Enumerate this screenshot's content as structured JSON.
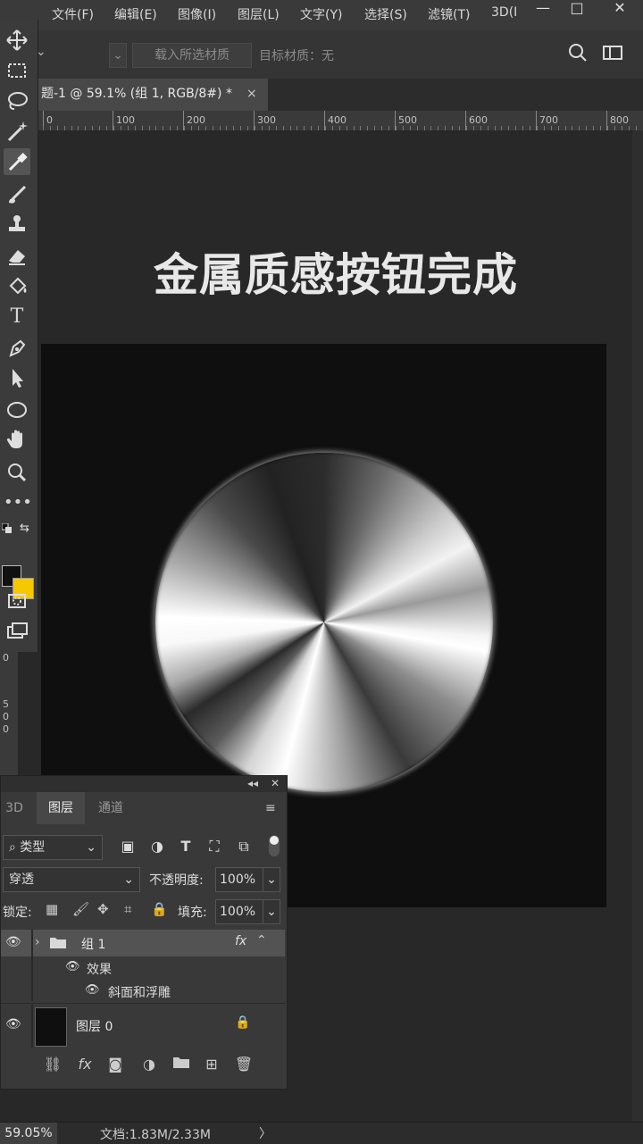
{
  "menu": [
    "文件(F)",
    "编辑(E)",
    "图像(I)",
    "图层(L)",
    "文字(Y)",
    "选择(S)",
    "滤镜(T)",
    "3D(I"
  ],
  "window_controls": [
    "—",
    "□",
    "✕"
  ],
  "options": {
    "load_material_label": "载入所选材质",
    "target_material_label": "目标材质：无"
  },
  "document_tab": {
    "title": "题-1 @ 59.1% (组 1, RGB/8#) *",
    "close": "×"
  },
  "ruler": {
    "h_ticks": [
      "0",
      "100",
      "200",
      "300",
      "400",
      "500",
      "600",
      "700",
      "800"
    ],
    "v_ticks": [
      "0",
      "5",
      "0",
      "0"
    ]
  },
  "canvas": {
    "headline": "金属质感按钮完成",
    "artboard_color": "#0f0f0f",
    "button_style": "brushed-metal-conic"
  },
  "toolbar": {
    "tools": [
      "move-icon",
      "marquee-icon",
      "lasso-icon",
      "magic-wand-icon",
      "eyedropper-icon",
      "brush-icon",
      "stamp-icon",
      "eraser-icon",
      "paint-bucket-icon",
      "type-icon",
      "pen-icon",
      "path-select-icon",
      "ellipse-icon",
      "hand-icon",
      "zoom-icon",
      "more-icon"
    ],
    "foreground_color": "#111111",
    "background_color": "#f6c800"
  },
  "layers_panel": {
    "tabs": [
      "3D",
      "图层",
      "通道"
    ],
    "active_tab": "图层",
    "filter_kind": "类型",
    "blend_mode": "穿透",
    "opacity_label": "不透明度:",
    "opacity_value": "100%",
    "lock_label": "锁定:",
    "fill_label": "填充:",
    "fill_value": "100%",
    "layers": [
      {
        "name": "组 1",
        "type": "group",
        "fx": "fx",
        "effects_label": "效果",
        "effect": "斜面和浮雕"
      },
      {
        "name": "图层 0",
        "type": "layer",
        "locked": true
      }
    ]
  },
  "status": {
    "zoom": "59.05%",
    "doc_info": "文档:1.83M/2.33M",
    "arrow": "〉"
  }
}
